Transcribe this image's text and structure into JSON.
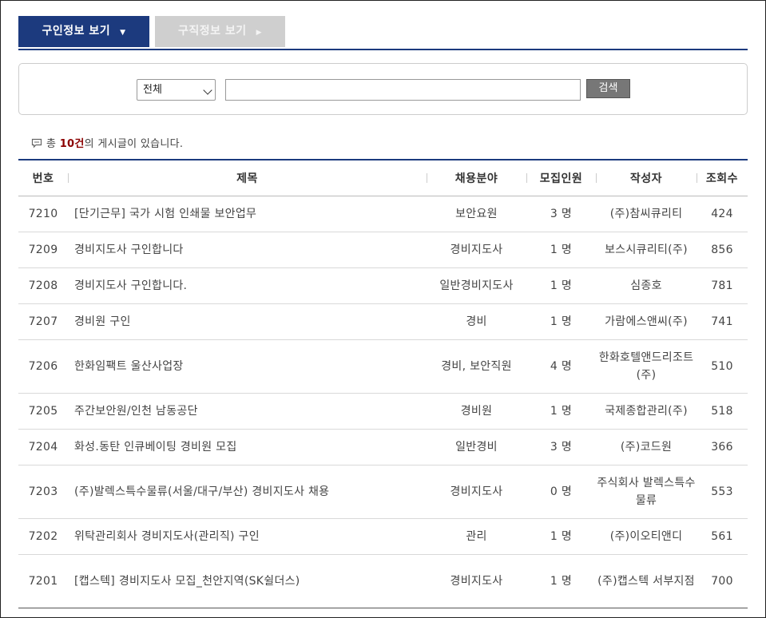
{
  "tabs": [
    {
      "label": "구인정보 보기",
      "caret": "▼",
      "active": true
    },
    {
      "label": "구직정보 보기",
      "caret": "▶",
      "active": false
    }
  ],
  "search": {
    "select_value": "전체",
    "input_value": "",
    "button_label": "검색"
  },
  "count_line": {
    "prefix": "총 ",
    "count": "10건",
    "suffix": "의 게시글이 있습니다."
  },
  "table": {
    "headers": [
      "번호",
      "제목",
      "채용분야",
      "모집인원",
      "작성자",
      "조회수"
    ],
    "rows": [
      {
        "no": "7210",
        "title": "[단기근무] 국가 시험 인쇄물 보안업무",
        "field": "보안요원",
        "count": "3 명",
        "author": "(주)참씨큐리티",
        "views": "424"
      },
      {
        "no": "7209",
        "title": "경비지도사 구인합니다",
        "field": "경비지도사",
        "count": "1 명",
        "author": "보스시큐리티(주)",
        "views": "856"
      },
      {
        "no": "7208",
        "title": "경비지도사 구인합니다.",
        "field": "일반경비지도사",
        "count": "1 명",
        "author": "심종호",
        "views": "781"
      },
      {
        "no": "7207",
        "title": "경비원 구인",
        "field": "경비",
        "count": "1 명",
        "author": "가람에스앤씨(주)",
        "views": "741"
      },
      {
        "no": "7206",
        "title": "한화임팩트 울산사업장",
        "field": "경비, 보안직원",
        "count": "4 명",
        "author": "한화호텔앤드리조트(주)",
        "views": "510"
      },
      {
        "no": "7205",
        "title": "주간보안원/인천 남동공단",
        "field": "경비원",
        "count": "1 명",
        "author": "국제종합관리(주)",
        "views": "518"
      },
      {
        "no": "7204",
        "title": "화성.동탄 인큐베이팅 경비원 모집",
        "field": "일반경비",
        "count": "3 명",
        "author": "(주)코드원",
        "views": "366"
      },
      {
        "no": "7203",
        "title": "(주)발렉스특수물류(서울/대구/부산) 경비지도사 채용",
        "field": "경비지도사",
        "count": "0 명",
        "author": "주식회사 발렉스특수물류",
        "views": "553"
      },
      {
        "no": "7202",
        "title": "위탁관리회사 경비지도사(관리직) 구인",
        "field": "관리",
        "count": "1 명",
        "author": "(주)이오티앤디",
        "views": "561"
      },
      {
        "no": "7201",
        "title": "[캡스텍] 경비지도사 모집_천안지역(SK쉴더스)",
        "field": "경비지도사",
        "count": "1 명",
        "author": "(주)캡스텍 서부지점",
        "views": "700"
      }
    ]
  },
  "colors": {
    "accent": "#1c3a7e",
    "count_highlight": "#8b0000",
    "inactive_tab": "#cfcfcf"
  }
}
